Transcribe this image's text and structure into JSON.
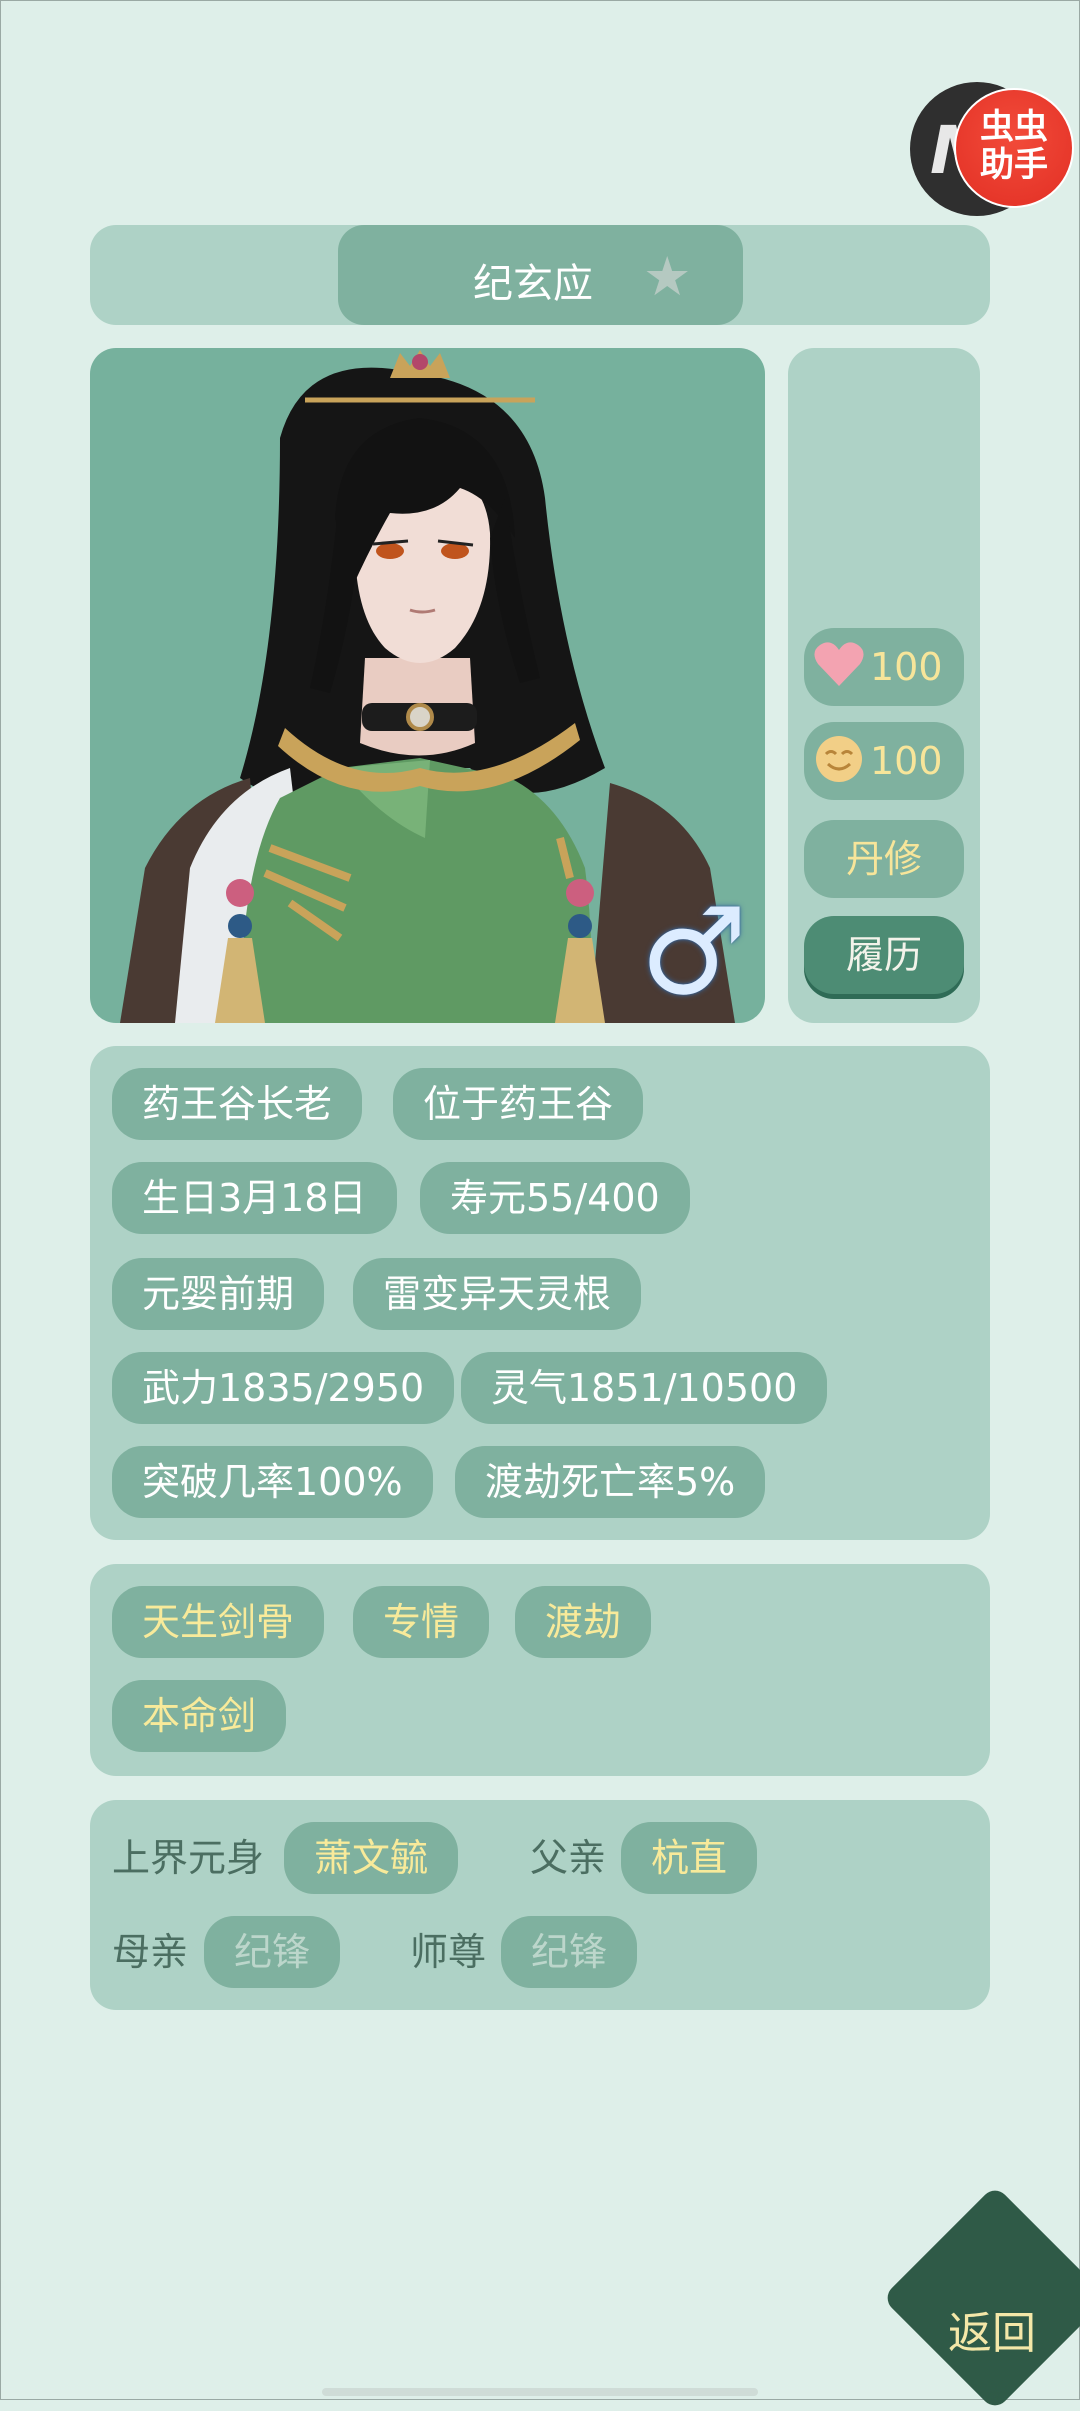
{
  "badge": {
    "letter": "M",
    "line1": "虫虫",
    "line2": "助手"
  },
  "character": {
    "name": "纪玄应",
    "star_icon": "star-icon",
    "gender_symbol": "♂"
  },
  "stats": {
    "health": "100",
    "mood": "100",
    "profession": "丹修",
    "history_button": "履历"
  },
  "info_tags": [
    "药王谷长老",
    "位于药王谷",
    "生日3月18日",
    "寿元55/400",
    "元婴前期",
    "雷变异天灵根",
    "武力1835/2950",
    "灵气1851/10500",
    "突破几率100%",
    "渡劫死亡率5%"
  ],
  "traits": [
    "天生剑骨",
    "专情",
    "渡劫",
    "本命剑"
  ],
  "relations": {
    "upper_label": "上界元身",
    "upper_value": "萧文毓",
    "father_label": "父亲",
    "father_value": "杭直",
    "mother_label": "母亲",
    "mother_value": "纪锋",
    "master_label": "师尊",
    "master_value": "纪锋"
  },
  "back_button": "返回",
  "colors": {
    "background": "#deefe9",
    "panel": "#aed2c6",
    "tag": "#7fb19f",
    "accent_text": "#f8ea9a",
    "back_button": "#2f5a47"
  }
}
